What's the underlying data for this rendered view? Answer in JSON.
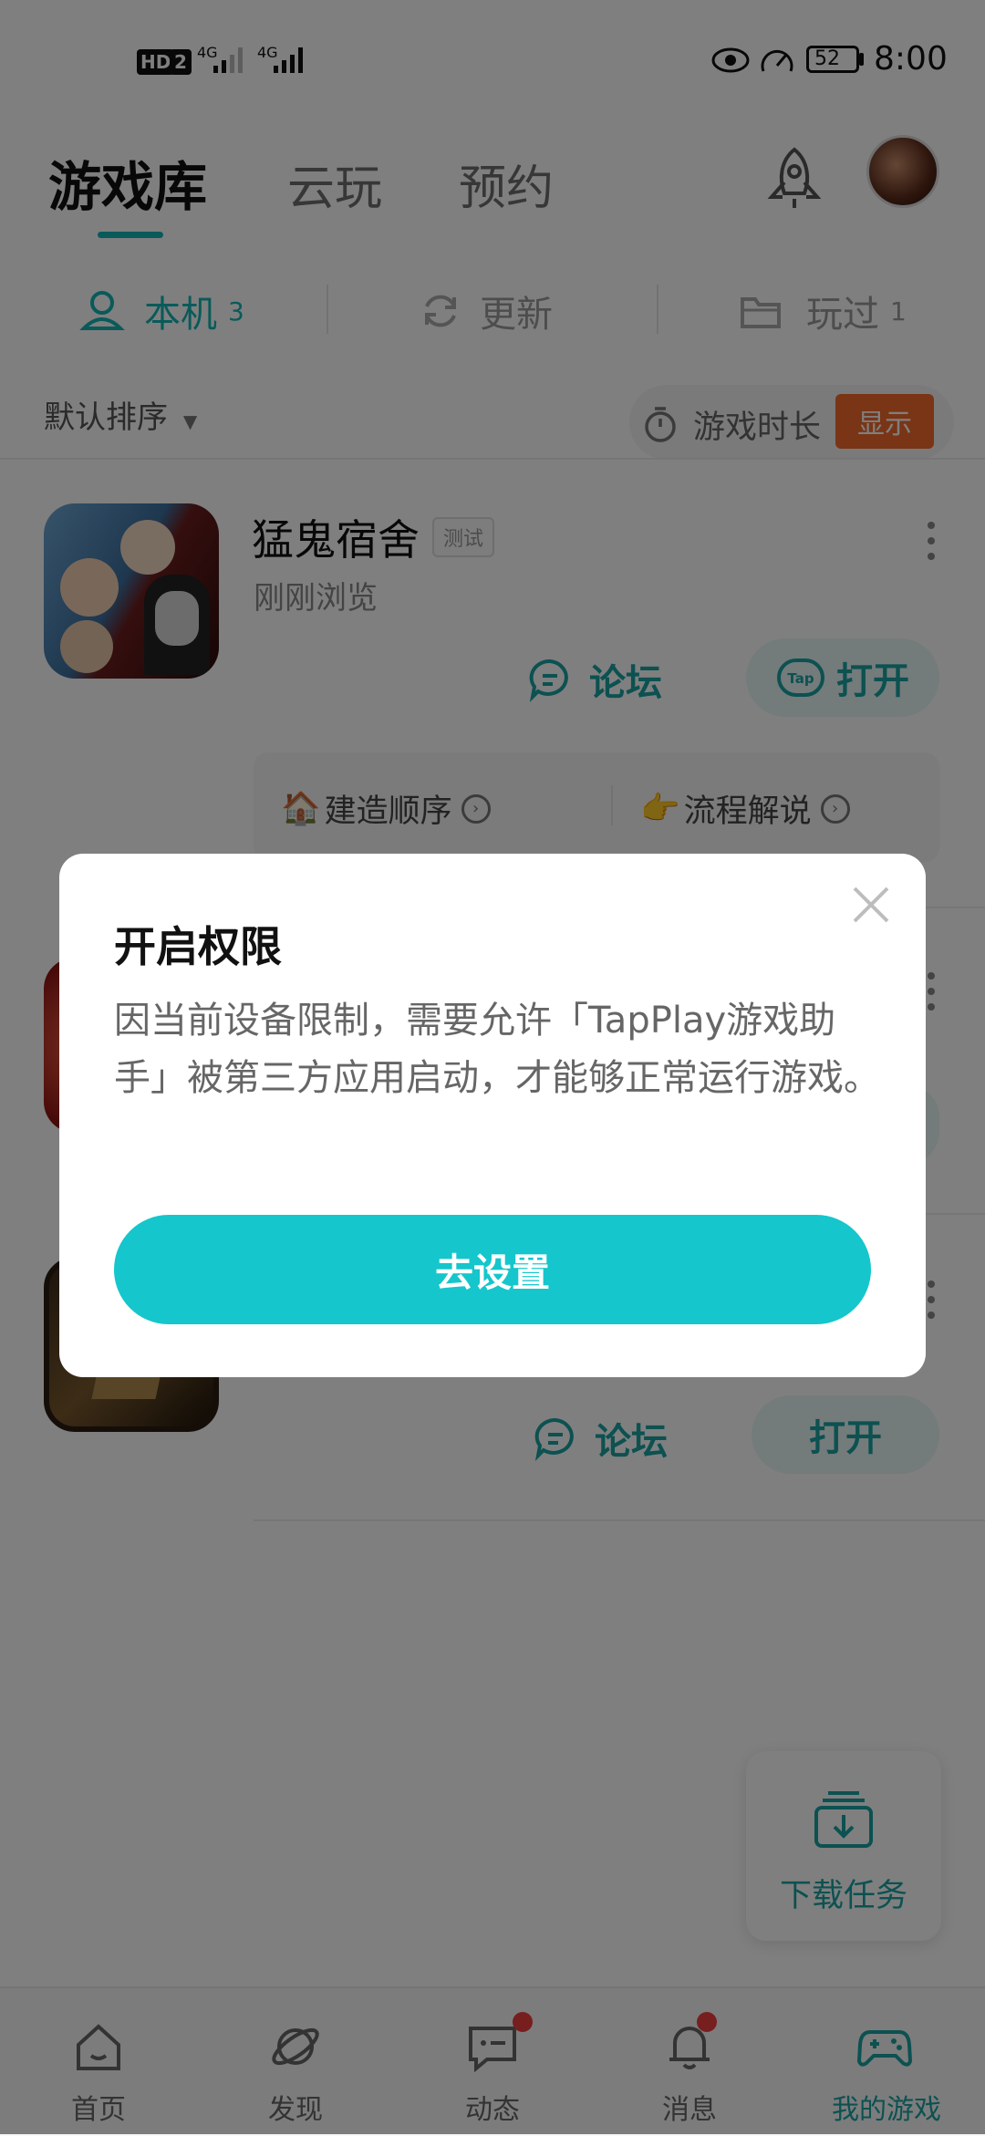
{
  "status_bar": {
    "network_badge": "HD",
    "sim_slot": "2",
    "signal1_label": "4G",
    "signal2_label": "4G",
    "battery": "52",
    "time": "8:00"
  },
  "header": {
    "tabs": [
      {
        "label": "游戏库",
        "active": true
      },
      {
        "label": "云玩",
        "active": false
      },
      {
        "label": "预约",
        "active": false
      }
    ],
    "rocket_icon": "rocket-icon",
    "avatar": "avatar"
  },
  "sub_tabs": [
    {
      "label": "本机",
      "count": "3",
      "icon": "user-device-icon",
      "active": true
    },
    {
      "label": "更新",
      "count": "",
      "icon": "refresh-icon",
      "active": false
    },
    {
      "label": "玩过",
      "count": "1",
      "icon": "folder-icon",
      "active": false
    }
  ],
  "sort": {
    "label": "默认排序",
    "playtime_label": "游戏时长",
    "playtime_button": "显示"
  },
  "games": [
    {
      "title": "猛鬼宿舍",
      "badge": "测试",
      "subtitle": "刚刚浏览",
      "forum_label": "论坛",
      "open_label": "打开",
      "guides": [
        {
          "emoji": "🏠",
          "label": "建造顺序"
        },
        {
          "emoji": "👉",
          "label": "流程解说"
        }
      ]
    },
    {
      "forum_label": "论坛",
      "open_label": "打开"
    }
  ],
  "download_task": {
    "label": "下载任务"
  },
  "bottom_nav": [
    {
      "label": "首页",
      "icon": "home-icon",
      "active": false,
      "dot": false
    },
    {
      "label": "发现",
      "icon": "planet-icon",
      "active": false,
      "dot": false
    },
    {
      "label": "动态",
      "icon": "chat-icon",
      "active": false,
      "dot": true
    },
    {
      "label": "消息",
      "icon": "bell-icon",
      "active": false,
      "dot": true
    },
    {
      "label": "我的游戏",
      "icon": "gamepad-icon",
      "active": true,
      "dot": false
    }
  ],
  "dialog": {
    "title": "开启权限",
    "body": "因当前设备限制，需要允许「TapPlay游戏助手」被第三方应用启动，才能够正常运行游戏。",
    "button": "去设置"
  },
  "colors": {
    "accent": "#15b5b4",
    "dialog_button": "#15c6cc",
    "badge_orange": "#f26b2a",
    "notification_red": "#ef3d3d"
  }
}
